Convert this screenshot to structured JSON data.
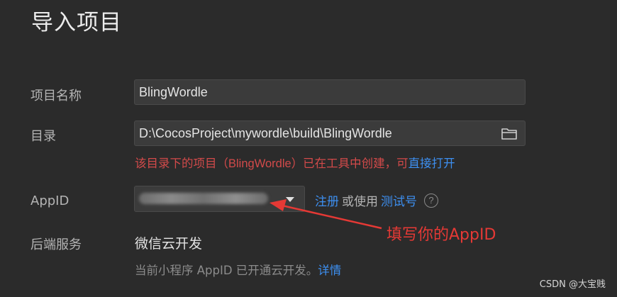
{
  "title": "导入项目",
  "labels": {
    "project_name": "项目名称",
    "directory": "目录",
    "appid": "AppID",
    "backend": "后端服务"
  },
  "fields": {
    "project_name_value": "BlingWordle",
    "directory_value": "D:\\CocosProject\\mywordle\\build\\BlingWordle"
  },
  "error": {
    "prefix": "该目录下的项目（",
    "project": "BlingWordle",
    "suffix": "）已在工具中创建，可",
    "link": "直接打开"
  },
  "appid": {
    "register_link": "注册",
    "or_use_text": "或使用",
    "test_link": "测试号",
    "help_glyph": "?"
  },
  "backend": {
    "value": "微信云开发",
    "desc": "当前小程序 AppID 已开通云开发。",
    "detail_link": "详情"
  },
  "annotation": {
    "text": "填写你的AppID",
    "color": "#e53935"
  },
  "watermark": "CSDN @大宝贱",
  "colors": {
    "background": "#2b2b2b",
    "field": "#3b3b3b",
    "link": "#3d8ff0",
    "error": "#d24a4a"
  },
  "icons": {
    "folder": "folder-icon",
    "dropdown": "chevron-down-icon",
    "help": "help-icon"
  }
}
